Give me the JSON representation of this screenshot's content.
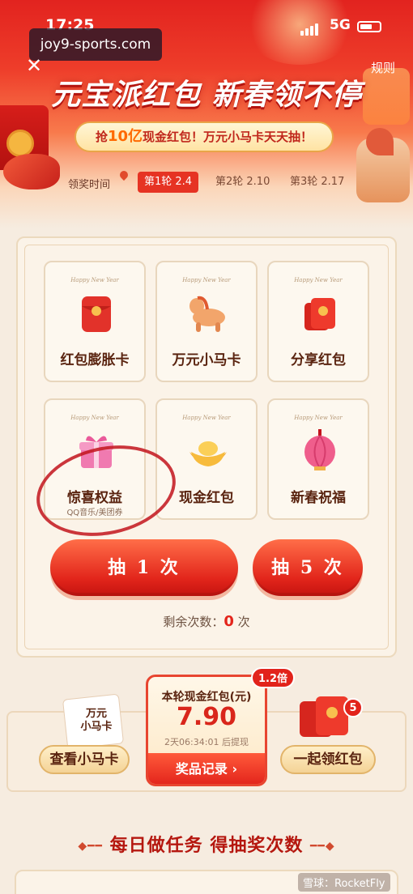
{
  "status": {
    "time": "17:25",
    "network": "5G"
  },
  "watermark": "joy9-sports.com",
  "header": {
    "title": "元宝派红包 新春领不停",
    "rules": "规则",
    "banner_prefix": "抢",
    "banner_highlight": "10亿",
    "banner_suffix": "现金红包！万元小马卡天天抽！",
    "rounds_label": "领奖时间",
    "rounds": [
      {
        "label": "第1轮 2.4",
        "active": true
      },
      {
        "label": "第2轮 2.10",
        "active": false
      },
      {
        "label": "第3轮 2.17",
        "active": false
      }
    ]
  },
  "tiles": [
    {
      "hny": "Happy New Year",
      "name": "红包膨胀卡",
      "sub": "",
      "icon": "red-envelope-icon"
    },
    {
      "hny": "Happy New Year",
      "name": "万元小马卡",
      "sub": "",
      "icon": "horse-icon"
    },
    {
      "hny": "Happy New Year",
      "name": "分享红包",
      "sub": "",
      "icon": "share-envelope-icon"
    },
    {
      "hny": "Happy New Year",
      "name": "惊喜权益",
      "sub": "QQ音乐/美团券",
      "icon": "gift-box-icon"
    },
    {
      "hny": "Happy New Year",
      "name": "现金红包",
      "sub": "",
      "icon": "gold-ingot-icon"
    },
    {
      "hny": "Happy New Year",
      "name": "新春祝福",
      "sub": "",
      "icon": "lantern-icon"
    }
  ],
  "draw": {
    "once": "抽 1 次",
    "five": "抽 5 次"
  },
  "remaining": {
    "label": "剩余次数：",
    "count": "0",
    "unit": "次"
  },
  "wallet": {
    "left_card_text": "万元\n小马卡",
    "left_button": "查看小马卡",
    "mid_title": "本轮现金红包(元)",
    "multiplier": "1.2倍",
    "amount": "7.90",
    "timer": "2天06:34:01 后提现",
    "record_button": "奖品记录 ›",
    "right_button": "一起领红包",
    "right_badge": "5"
  },
  "task_title": "每日做任务 得抽奖次数",
  "credit": "雪球：RocketFly"
}
